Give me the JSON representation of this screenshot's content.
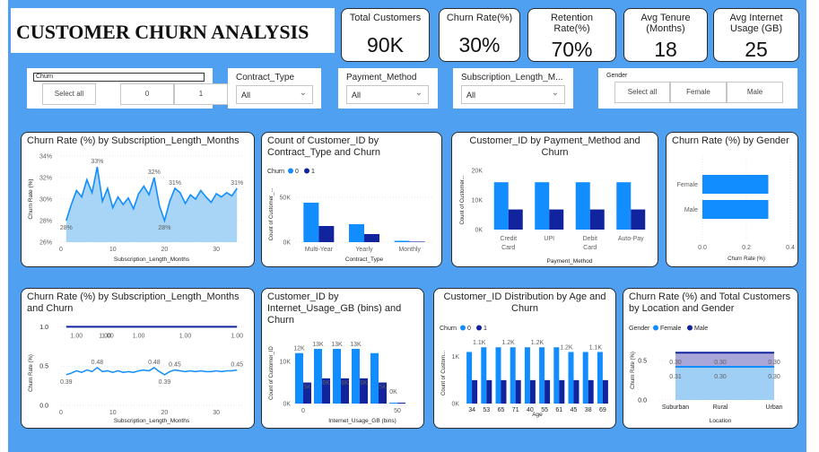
{
  "title": "CUSTOMER CHURN ANALYSIS",
  "kpis": [
    {
      "label": "Total Customers",
      "value": "90K"
    },
    {
      "label": "Churn Rate(%)",
      "value": "30%"
    },
    {
      "label": "Retention Rate(%)",
      "value": "70%"
    },
    {
      "label": "Avg Tenure (Months)",
      "value": "18"
    },
    {
      "label": "Avg Internet Usage (GB)",
      "value": "25"
    }
  ],
  "filters": {
    "churn": {
      "label": "Churn",
      "options": [
        "Select all",
        "0",
        "1"
      ]
    },
    "contract": {
      "label": "Contract_Type",
      "value": "All"
    },
    "payment": {
      "label": "Payment_Method",
      "value": "All"
    },
    "subscription": {
      "label": "Subscription_Length_M...",
      "value": "All"
    },
    "gender": {
      "label": "Gender",
      "options": [
        "Select all",
        "Female",
        "Male"
      ]
    }
  },
  "colors": {
    "churn0": "#118dff",
    "churn1": "#12239e",
    "area": "#9fcff5",
    "line": "#118dff"
  },
  "chart_data": [
    {
      "type": "area",
      "title": "Churn Rate (%) by Subscription_Length_Months",
      "xlabel": "Subscription_Length_Months",
      "ylabel": "Churn Rate (%)",
      "ylim": [
        26,
        34
      ],
      "yticks": [
        "34%",
        "32%",
        "30%",
        "28%",
        "26%"
      ],
      "xticks": [
        "0",
        "10",
        "20",
        "30"
      ],
      "x": [
        1,
        2,
        3,
        4,
        5,
        6,
        7,
        8,
        9,
        10,
        11,
        12,
        13,
        14,
        15,
        16,
        17,
        18,
        19,
        20,
        21,
        22,
        23,
        24,
        25,
        26,
        27,
        28,
        29,
        30,
        31,
        32,
        33,
        34
      ],
      "values": [
        28.0,
        29.5,
        30.8,
        30.2,
        31.8,
        30.6,
        33.0,
        29.8,
        31.0,
        29.2,
        30.2,
        29.5,
        30.1,
        29.1,
        30.5,
        31.2,
        30.4,
        32.0,
        29.4,
        28.0,
        29.8,
        31.0,
        30.6,
        29.6,
        30.4,
        30.0,
        30.8,
        30.2,
        29.7,
        30.5,
        30.2,
        30.6,
        30.3,
        31.0
      ],
      "annotations": [
        {
          "x": 1,
          "label": "28%"
        },
        {
          "x": 7,
          "label": "33%"
        },
        {
          "x": 18,
          "label": "32%"
        },
        {
          "x": 20,
          "label": "28%"
        },
        {
          "x": 22,
          "label": "31%"
        },
        {
          "x": 34,
          "label": "31%"
        }
      ],
      "grid": true
    },
    {
      "type": "bar",
      "title": "Count of Customer_ID by Contract_Type and Churn",
      "legend_title": "Churn",
      "legend": [
        "0",
        "1"
      ],
      "categories": [
        "Multi-Year",
        "Yearly",
        "Monthly"
      ],
      "series": [
        {
          "name": "0",
          "values": [
            44000,
            20000,
            1500
          ]
        },
        {
          "name": "1",
          "values": [
            18000,
            9000,
            600
          ]
        }
      ],
      "xlabel": "Contract_Type",
      "ylabel": "Count of Customer_...",
      "ylim": [
        0,
        62000
      ],
      "yticks": [
        "50K",
        "0K"
      ]
    },
    {
      "type": "bar",
      "title": "Customer_ID by Payment_Method and Churn",
      "categories": [
        "Credit Card",
        "UPI",
        "Debit Card",
        "Auto-Pay"
      ],
      "series": [
        {
          "name": "0",
          "values": [
            16000,
            16000,
            16000,
            16000
          ]
        },
        {
          "name": "1",
          "values": [
            6800,
            6800,
            6800,
            6800
          ]
        }
      ],
      "xlabel": "Payment_Method",
      "ylabel": "Count of Customer...",
      "ylim": [
        0,
        20000
      ],
      "yticks": [
        "20K",
        "10K",
        "0K"
      ]
    },
    {
      "type": "bar",
      "title": "Churn Rate (%) by Gender",
      "categories": [
        "Female",
        "Male"
      ],
      "values": [
        0.3,
        0.3
      ],
      "xlabel": "Churn Rate (%)",
      "ylabel": "",
      "xlim": [
        0,
        0.4
      ],
      "xticks": [
        "0.0",
        "0.2",
        "0.4"
      ],
      "grid": true
    },
    {
      "type": "line",
      "title": "Churn Rate (%) by Subscription_Length_Months and Churn",
      "xlabel": "Subscription_Length_Months",
      "ylabel": "Churn Rate (%)",
      "ylim": [
        0,
        1.05
      ],
      "yticks": [
        "1.0",
        "0.5",
        "0.0"
      ],
      "xticks": [
        "0",
        "10",
        "20",
        "30"
      ],
      "x": [
        1,
        2,
        3,
        4,
        5,
        6,
        7,
        8,
        9,
        10,
        11,
        12,
        13,
        14,
        15,
        16,
        17,
        18,
        19,
        20,
        21,
        22,
        23,
        24,
        25,
        26,
        27,
        28,
        29,
        30,
        31,
        32,
        33,
        34
      ],
      "series": [
        {
          "name": "1",
          "values": [
            1,
            1,
            1,
            1,
            1,
            1,
            1,
            1,
            1,
            1,
            1,
            1,
            1,
            1,
            1,
            1,
            1,
            1,
            1,
            1,
            1,
            1,
            1,
            1,
            1,
            1,
            1,
            1,
            1,
            1,
            1,
            1,
            1,
            1
          ]
        },
        {
          "name": "0",
          "values": [
            0.39,
            0.41,
            0.44,
            0.42,
            0.45,
            0.43,
            0.48,
            0.43,
            0.44,
            0.42,
            0.44,
            0.42,
            0.43,
            0.42,
            0.44,
            0.45,
            0.44,
            0.48,
            0.43,
            0.39,
            0.43,
            0.45,
            0.44,
            0.43,
            0.44,
            0.43,
            0.44,
            0.43,
            0.43,
            0.44,
            0.43,
            0.44,
            0.44,
            0.45
          ]
        }
      ],
      "labels_top": [
        "1.00",
        "1.00",
        "1.00",
        "1.00",
        "1.00",
        "1.00"
      ],
      "labels_bottom": [
        {
          "x": 1,
          "label": "0.39"
        },
        {
          "x": 7,
          "label": "0.48"
        },
        {
          "x": 18,
          "label": "0.48"
        },
        {
          "x": 20,
          "label": "0.39"
        },
        {
          "x": 22,
          "label": "0.45"
        },
        {
          "x": 34,
          "label": "0.45"
        }
      ],
      "grid": true
    },
    {
      "type": "bar",
      "title": "Customer_ID by Internet_Usage_GB (bins) and Churn",
      "categories": [
        "0",
        "10",
        "20",
        "30",
        "40",
        "50"
      ],
      "xtick_labels": [
        "0",
        "50"
      ],
      "series": [
        {
          "name": "0",
          "values": [
            12000,
            13000,
            13000,
            13000,
            12000,
            0
          ]
        },
        {
          "name": "1",
          "values": [
            5000,
            6000,
            6000,
            6000,
            5000,
            0
          ]
        }
      ],
      "data_labels": [
        [
          "12K",
          "5K"
        ],
        [
          "13K",
          "6K"
        ],
        [
          "13K",
          "6K"
        ],
        [
          "13K",
          "6K"
        ],
        [
          "",
          "5K"
        ],
        [
          "0K",
          ""
        ]
      ],
      "xlabel": "Internet_Usage_GB (bins)",
      "ylabel": "Count of Customer_ID",
      "ylim": [
        0,
        14500
      ],
      "yticks": [
        "10K",
        "0K"
      ]
    },
    {
      "type": "bar",
      "title": "Customer_ID Distribution by Age and Churn",
      "legend_title": "Churn",
      "legend": [
        "0",
        "1"
      ],
      "categories": [
        "34",
        "53",
        "65",
        "71",
        "40",
        "55",
        "61",
        "45",
        "38",
        "69"
      ],
      "series": [
        {
          "name": "0",
          "values": [
            1100,
            1200,
            1200,
            1200,
            1200,
            1200,
            1200,
            1100,
            1100,
            1100
          ]
        },
        {
          "name": "1",
          "values": [
            500,
            500,
            500,
            500,
            500,
            500,
            500,
            500,
            500,
            500
          ]
        }
      ],
      "top_labels": [
        "1.1K",
        "1.2K",
        "1.2K",
        "1.2K",
        "1.1K"
      ],
      "xlabel": "Age",
      "ylabel": "Count of Custom...",
      "ylim": [
        0,
        1300
      ],
      "yticks": [
        "1K",
        "0K"
      ]
    },
    {
      "type": "area",
      "title": "Churn Rate (%) and Total Customers by Location and Gender",
      "legend_title": "Gender",
      "legend": [
        "Female",
        "Male"
      ],
      "categories": [
        "Suburban",
        "Rural",
        "Urban"
      ],
      "series": [
        {
          "name": "Male",
          "values": [
            0.6,
            0.6,
            0.6
          ]
        },
        {
          "name": "Female",
          "values": [
            0.42,
            0.42,
            0.42
          ]
        }
      ],
      "data_labels": [
        [
          "0.30",
          "0.30",
          "0.30"
        ],
        [
          "0.31",
          "0.30",
          "0.30"
        ]
      ],
      "xlabel": "Location",
      "ylabel": "Churn Rate (%)",
      "ylim": [
        0,
        0.75
      ],
      "yticks": [
        "0.5",
        "0.0"
      ]
    }
  ]
}
